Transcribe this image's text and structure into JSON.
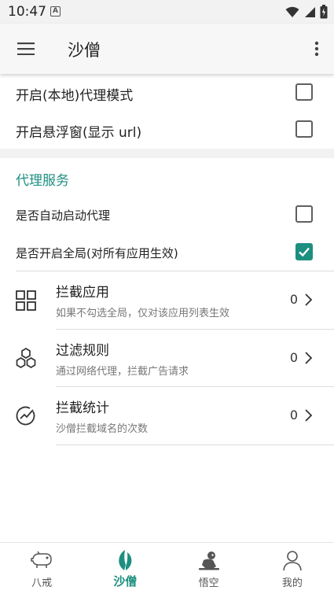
{
  "status_bar": {
    "time": "10:47",
    "notif_badge": "A"
  },
  "app_bar": {
    "title": "沙僧",
    "menu_icon": "hamburger-menu-icon",
    "more_icon": "more-vert-icon"
  },
  "proxy_options": [
    {
      "label": "开启(本地)代理模式",
      "checked": false
    },
    {
      "label": "开启悬浮窗(显示 url)",
      "checked": false
    }
  ],
  "proxy_service": {
    "section_title": "代理服务",
    "toggles": [
      {
        "label": "是否自动启动代理",
        "checked": false
      },
      {
        "label": "是否开启全局(对所有应用生效)",
        "checked": true
      }
    ],
    "nav_rows": [
      {
        "title": "拦截应用",
        "subtitle": "如果不勾选全局，仅对该应用列表生效",
        "count": "0",
        "icon": "grid-apps-icon"
      },
      {
        "title": "过滤规则",
        "subtitle": "通过网络代理，拦截广告请求",
        "count": "0",
        "icon": "hexagons-icon"
      },
      {
        "title": "拦截统计",
        "subtitle": "沙僧拦截域名的次数",
        "count": "0",
        "icon": "stats-check-icon"
      }
    ]
  },
  "bottom_nav": [
    {
      "label": "八戒",
      "icon": "pig-icon",
      "active": false
    },
    {
      "label": "沙僧",
      "icon": "leaf-icon",
      "active": true
    },
    {
      "label": "悟空",
      "icon": "monkey-icon",
      "active": false
    },
    {
      "label": "我的",
      "icon": "person-icon",
      "active": false
    }
  ],
  "colors": {
    "accent": "#1d8f80",
    "background": "#f2f2f2"
  }
}
